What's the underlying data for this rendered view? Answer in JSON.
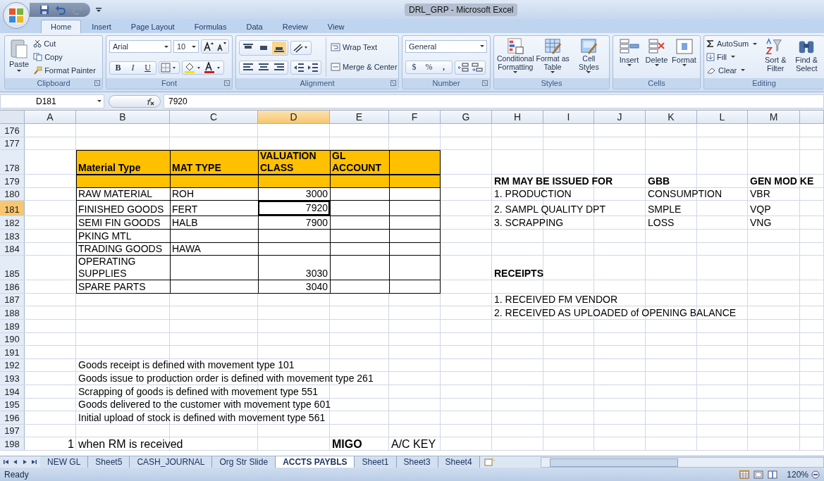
{
  "window": {
    "title": "DRL_GRP - Microsoft Excel"
  },
  "ribbon_tabs": [
    {
      "label": "Home",
      "selected": true
    },
    {
      "label": "Insert",
      "selected": false
    },
    {
      "label": "Page Layout",
      "selected": false
    },
    {
      "label": "Formulas",
      "selected": false
    },
    {
      "label": "Data",
      "selected": false
    },
    {
      "label": "Review",
      "selected": false
    },
    {
      "label": "View",
      "selected": false
    }
  ],
  "clipboard": {
    "label": "Clipboard",
    "paste": "Paste",
    "cut": "Cut",
    "copy": "Copy",
    "format_painter": "Format Painter"
  },
  "font": {
    "label": "Font",
    "family": "Arial",
    "size": "10",
    "bold": "B",
    "italic": "I",
    "underline": "U"
  },
  "alignment": {
    "label": "Alignment",
    "wrap_text": "Wrap Text",
    "merge": "Merge & Center",
    "vertical": [
      {
        "kind": "top",
        "selected": false
      },
      {
        "kind": "middle",
        "selected": false
      },
      {
        "kind": "bottom",
        "selected": true
      }
    ]
  },
  "number": {
    "label": "Number",
    "format": "General",
    "currency": "$",
    "percent": "%",
    "comma": ","
  },
  "styles": {
    "label": "Styles",
    "buttons": [
      {
        "label": "Conditional Formatting",
        "kind": "conditional"
      },
      {
        "label": "Format as Table",
        "kind": "table"
      },
      {
        "label": "Cell Styles",
        "kind": "styles"
      }
    ]
  },
  "cells": {
    "label": "Cells",
    "buttons": [
      {
        "label": "Insert",
        "kind": "insert"
      },
      {
        "label": "Delete",
        "kind": "delete"
      },
      {
        "label": "Format",
        "kind": "format"
      }
    ]
  },
  "editing": {
    "label": "Editing",
    "autosum": "AutoSum",
    "fill": "Fill",
    "clear": "Clear",
    "sort": "Sort & Filter",
    "find": "Find & Select"
  },
  "formula_bar": {
    "name_box": "D181",
    "value": "7920"
  },
  "column_headers": [
    {
      "label": "A",
      "selected": false
    },
    {
      "label": "B",
      "selected": false
    },
    {
      "label": "C",
      "selected": false
    },
    {
      "label": "D",
      "selected": true
    },
    {
      "label": "E",
      "selected": false
    },
    {
      "label": "F",
      "selected": false
    },
    {
      "label": "G",
      "selected": false
    },
    {
      "label": "H",
      "selected": false
    },
    {
      "label": "I",
      "selected": false
    },
    {
      "label": "J",
      "selected": false
    },
    {
      "label": "K",
      "selected": false
    },
    {
      "label": "L",
      "selected": false
    },
    {
      "label": "M",
      "selected": false
    }
  ],
  "rows": [
    {
      "number": "176",
      "selected": false,
      "kind": "plain",
      "cells": {}
    },
    {
      "number": "177",
      "selected": false,
      "kind": "plain",
      "cells": {}
    },
    {
      "number": "178",
      "selected": false,
      "kind": "header",
      "cells": {
        "B": {
          "text": "Material Type",
          "kind": "heading",
          "selected": false
        },
        "C": {
          "text": "MAT TYPE",
          "kind": "heading",
          "selected": false
        },
        "D": {
          "text": "VALUATION CLASS",
          "kind": "heading",
          "selected": false
        },
        "E": {
          "text": "GL ACCOUNT",
          "kind": "heading",
          "selected": false
        }
      }
    },
    {
      "number": "179",
      "selected": false,
      "kind": "header",
      "cells": {
        "H": {
          "text": "RM MAY BE ISSUED  FOR",
          "kind": "bold",
          "selected": false
        },
        "K": {
          "text": "GBB",
          "kind": "bold",
          "selected": false
        },
        "M": {
          "text": "GEN MOD KE",
          "kind": "bold",
          "selected": false
        }
      }
    },
    {
      "number": "180",
      "selected": false,
      "kind": "table",
      "cells": {
        "B": {
          "text": "RAW MATERIAL",
          "kind": "entry",
          "selected": false
        },
        "C": {
          "text": "ROH",
          "kind": "entry",
          "selected": false
        },
        "D": {
          "text": "3000",
          "kind": "number",
          "selected": false
        },
        "H": {
          "text": "1. PRODUCTION",
          "kind": "text",
          "selected": false
        },
        "K": {
          "text": "CONSUMPTION",
          "kind": "text",
          "selected": false
        },
        "M": {
          "text": "VBR",
          "kind": "text",
          "selected": false
        }
      }
    },
    {
      "number": "181",
      "selected": true,
      "kind": "table",
      "cells": {
        "B": {
          "text": "FINISHED GOODS",
          "kind": "entry",
          "selected": false
        },
        "C": {
          "text": "FERT",
          "kind": "entry",
          "selected": false
        },
        "D": {
          "text": "7920",
          "kind": "number",
          "selected": true
        },
        "H": {
          "text": "2. SAMPL QUALITY DPT",
          "kind": "text",
          "selected": false
        },
        "K": {
          "text": "SMPLE",
          "kind": "text",
          "selected": false
        },
        "M": {
          "text": "VQP",
          "kind": "text",
          "selected": false
        }
      }
    },
    {
      "number": "182",
      "selected": false,
      "kind": "table",
      "cells": {
        "B": {
          "text": "SEMI FIN GOODS",
          "kind": "entry",
          "selected": false
        },
        "C": {
          "text": "HALB",
          "kind": "entry",
          "selected": false
        },
        "D": {
          "text": "7900",
          "kind": "number",
          "selected": false
        },
        "H": {
          "text": "3. SCRAPPING",
          "kind": "text",
          "selected": false
        },
        "K": {
          "text": "LOSS",
          "kind": "text",
          "selected": false
        },
        "M": {
          "text": "VNG",
          "kind": "text",
          "selected": false
        }
      }
    },
    {
      "number": "183",
      "selected": false,
      "kind": "table",
      "cells": {
        "B": {
          "text": "PKING MTL",
          "kind": "entry",
          "selected": false
        }
      }
    },
    {
      "number": "184",
      "selected": false,
      "kind": "table",
      "cells": {
        "B": {
          "text": "TRADING GOODS",
          "kind": "entry",
          "selected": false
        },
        "C": {
          "text": "HAWA",
          "kind": "entry",
          "selected": false
        }
      }
    },
    {
      "number": "185",
      "selected": false,
      "kind": "table",
      "cells": {
        "B": {
          "text": "OPERATING SUPPLIES",
          "kind": "entry",
          "selected": false
        },
        "D": {
          "text": "3030",
          "kind": "number",
          "selected": false
        },
        "H": {
          "text": "RECEIPTS",
          "kind": "bold",
          "selected": false
        }
      }
    },
    {
      "number": "186",
      "selected": false,
      "kind": "table",
      "cells": {
        "B": {
          "text": "SPARE PARTS",
          "kind": "entry",
          "selected": false
        },
        "D": {
          "text": "3040",
          "kind": "number",
          "selected": false
        }
      }
    },
    {
      "number": "187",
      "selected": false,
      "kind": "plain",
      "cells": {
        "H": {
          "text": "1. RECEIVED FM VENDOR",
          "kind": "text",
          "selected": false
        }
      }
    },
    {
      "number": "188",
      "selected": false,
      "kind": "plain",
      "cells": {
        "H": {
          "text": "2. RECEIVED AS UPLOADED of OPENING BALANCE",
          "kind": "text",
          "selected": false
        }
      }
    },
    {
      "number": "189",
      "selected": false,
      "kind": "plain",
      "cells": {}
    },
    {
      "number": "190",
      "selected": false,
      "kind": "plain",
      "cells": {}
    },
    {
      "number": "191",
      "selected": false,
      "kind": "plain",
      "cells": {}
    },
    {
      "number": "192",
      "selected": false,
      "kind": "plain",
      "cells": {
        "B": {
          "text": "Goods receipt is defined with movement type 101",
          "kind": "text",
          "selected": false
        }
      }
    },
    {
      "number": "193",
      "selected": false,
      "kind": "plain",
      "cells": {
        "B": {
          "text": "Goods issue to production order is defined with movement type 261",
          "kind": "text",
          "selected": false
        }
      }
    },
    {
      "number": "194",
      "selected": false,
      "kind": "plain",
      "cells": {
        "B": {
          "text": "Scrapping of goods is defined with movement type 551",
          "kind": "text",
          "selected": false
        }
      }
    },
    {
      "number": "195",
      "selected": false,
      "kind": "plain",
      "cells": {
        "B": {
          "text": "Goods delivered to the customer with movement type 601",
          "kind": "text",
          "selected": false
        }
      }
    },
    {
      "number": "196",
      "selected": false,
      "kind": "plain",
      "cells": {
        "B": {
          "text": "Initial upload of stock is defined with movement type 561",
          "kind": "text",
          "selected": false
        }
      }
    },
    {
      "number": "197",
      "selected": false,
      "kind": "plain",
      "cells": {}
    },
    {
      "number": "198",
      "selected": false,
      "kind": "plain",
      "cells": {
        "A": {
          "text": "1",
          "kind": "large-number",
          "selected": false
        },
        "B": {
          "text": "when RM is received",
          "kind": "large",
          "selected": false
        },
        "E": {
          "text": "MIGO",
          "kind": "large-bold",
          "selected": false
        },
        "F": {
          "text": "A/C KEY",
          "kind": "large",
          "selected": false
        }
      }
    }
  ],
  "sheet_tabs": [
    {
      "label": "NEW GL",
      "selected": false
    },
    {
      "label": "Sheet5",
      "selected": false
    },
    {
      "label": "CASH_JOURNAL",
      "selected": false
    },
    {
      "label": "Org Str Slide",
      "selected": false
    },
    {
      "label": "ACCTS PAYBLS",
      "selected": true
    },
    {
      "label": "Sheet1",
      "selected": false
    },
    {
      "label": "Sheet3",
      "selected": false
    },
    {
      "label": "Sheet4",
      "selected": false
    }
  ],
  "status_bar": {
    "text": "Ready",
    "zoom": "120%",
    "views": [
      {
        "kind": "normal",
        "selected": true
      },
      {
        "kind": "layout",
        "selected": false
      },
      {
        "kind": "break",
        "selected": false
      }
    ]
  }
}
